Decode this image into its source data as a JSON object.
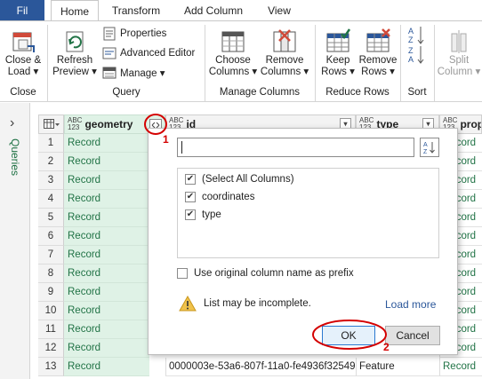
{
  "tabs": {
    "file": "Fil",
    "home": "Home",
    "transform": "Transform",
    "add_column": "Add Column",
    "view": "View"
  },
  "ribbon": {
    "close_load": [
      "Close &",
      "Load ▾"
    ],
    "refresh_preview": [
      "Refresh",
      "Preview ▾"
    ],
    "properties": "Properties",
    "advanced_editor": "Advanced Editor",
    "manage": "Manage ▾",
    "choose_columns": [
      "Choose",
      "Columns ▾"
    ],
    "remove_columns": [
      "Remove",
      "Columns ▾"
    ],
    "keep_rows": [
      "Keep",
      "Rows ▾"
    ],
    "remove_rows": [
      "Remove",
      "Rows ▾"
    ],
    "split_column": [
      "Split",
      "Column ▾"
    ],
    "groups": {
      "close": "Close",
      "query": "Query",
      "manage_columns": "Manage Columns",
      "reduce_rows": "Reduce Rows",
      "sort": "Sort"
    }
  },
  "left_pane": {
    "label": "Queries",
    "toggle": "›"
  },
  "grid": {
    "type_badge": [
      "ABC",
      "123"
    ],
    "columns": [
      "geometry",
      "id",
      "type",
      "prop"
    ],
    "rows": [
      {
        "n": "1",
        "geometry": "Record",
        "prop": "Record"
      },
      {
        "n": "2",
        "geometry": "Record",
        "prop": "Record"
      },
      {
        "n": "3",
        "geometry": "Record",
        "prop": "Record"
      },
      {
        "n": "4",
        "geometry": "Record",
        "prop": "Record"
      },
      {
        "n": "5",
        "geometry": "Record",
        "prop": "Record"
      },
      {
        "n": "6",
        "geometry": "Record",
        "prop": "Record"
      },
      {
        "n": "7",
        "geometry": "Record",
        "prop": "Record"
      },
      {
        "n": "8",
        "geometry": "Record",
        "prop": "Record"
      },
      {
        "n": "9",
        "geometry": "Record",
        "prop": "Record"
      },
      {
        "n": "10",
        "geometry": "Record",
        "prop": "Record"
      },
      {
        "n": "11",
        "geometry": "Record",
        "prop": "Record"
      },
      {
        "n": "12",
        "geometry": "Record",
        "prop": "Record"
      },
      {
        "n": "13",
        "geometry": "Record",
        "id": "0000003e-53a6-807f-11a0-fe4936f32549",
        "type": "Feature",
        "prop": "Record"
      }
    ]
  },
  "popup": {
    "search_value": "",
    "options": [
      {
        "label": "(Select All Columns)",
        "checked": true
      },
      {
        "label": "coordinates",
        "checked": true
      },
      {
        "label": "type",
        "checked": true
      }
    ],
    "prefix_label": "Use original column name as prefix",
    "prefix_checked": false,
    "warning": "List may be incomplete.",
    "load_more": "Load more",
    "ok": "OK",
    "cancel": "Cancel"
  },
  "annotations": [
    "1",
    "2"
  ],
  "colors": {
    "accent": "#217346",
    "file_tab": "#2b579a",
    "annotation": "#d40000"
  }
}
